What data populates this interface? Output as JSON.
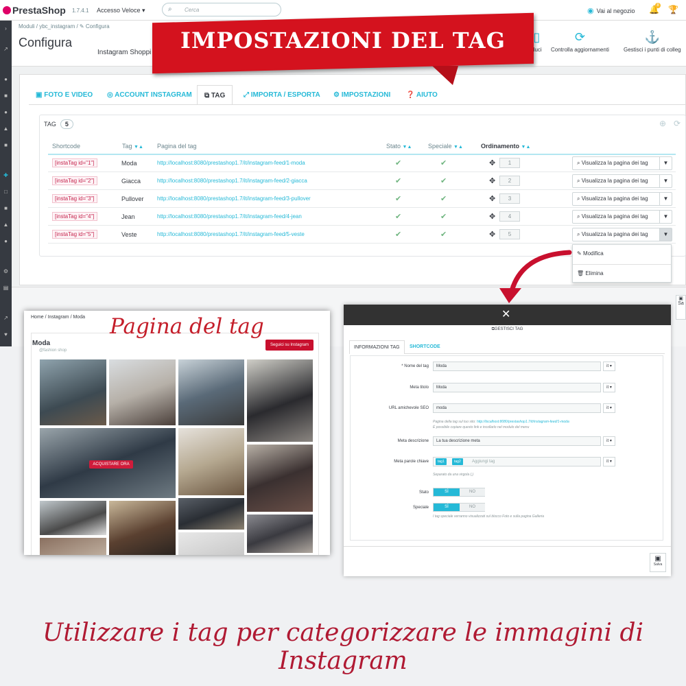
{
  "topbar": {
    "logo": "PrestaShop",
    "version": "1.7.4.1",
    "quick_access": "Accesso Veloce ▾",
    "search_placeholder": "Cerca",
    "view_shop": "Vai al negozio",
    "notif_count": "8"
  },
  "header": {
    "breadcrumb": "Moduli  /  ybc_instagram  /  ✎ Configura",
    "title": "Configura",
    "module_name": "Instagram Shoppi",
    "btn_products": "duci",
    "btn_check": "Controlla aggiornamenti",
    "btn_hooks": "Gestisci i punti di colleg"
  },
  "banner": {
    "text": "IMPOSTAZIONI DEL TAG"
  },
  "tabs": [
    {
      "label": "FOTO E VIDEO",
      "icon": "image-icon"
    },
    {
      "label": "ACCOUNT INSTAGRAM",
      "icon": "instagram-icon"
    },
    {
      "label": "TAG",
      "icon": "tags-icon"
    },
    {
      "label": "IMPORTA / ESPORTA",
      "icon": "arrows-icon"
    },
    {
      "label": "IMPOSTAZIONI",
      "icon": "cog-icon"
    },
    {
      "label": "AIUTO",
      "icon": "question-icon"
    }
  ],
  "list": {
    "heading": "TAG",
    "count": "5",
    "columns": {
      "shortcode": "Shortcode",
      "tag": "Tag",
      "page": "Pagina del tag",
      "stato": "Stato",
      "speciale": "Speciale",
      "ordinamento": "Ordinamento"
    },
    "rows": [
      {
        "shortcode": "[instaTag id=\"1\"]",
        "tag": "Moda",
        "url": "http://localhost:8080/prestashop1.7/it/instagram-feed/1-moda",
        "position": "1",
        "action": "Visualizza la pagina dei tag"
      },
      {
        "shortcode": "[instaTag id=\"2\"]",
        "tag": "Giacca",
        "url": "http://localhost:8080/prestashop1.7/it/instagram-feed/2-giacca",
        "position": "2",
        "action": "Visualizza la pagina dei tag"
      },
      {
        "shortcode": "[instaTag id=\"3\"]",
        "tag": "Pullover",
        "url": "http://localhost:8080/prestashop1.7/it/instagram-feed/3-pullover",
        "position": "3",
        "action": "Visualizza la pagina dei tag"
      },
      {
        "shortcode": "[instaTag id=\"4\"]",
        "tag": "Jean",
        "url": "http://localhost:8080/prestashop1.7/it/instagram-feed/4-jean",
        "position": "4",
        "action": "Visualizza la pagina dei tag"
      },
      {
        "shortcode": "[instaTag id=\"5\"]",
        "tag": "Veste",
        "url": "http://localhost:8080/prestashop1.7/it/instagram-feed/5-veste",
        "position": "5",
        "action": "Visualizza la pagina dei tag"
      }
    ],
    "dropdown": {
      "edit": "Modifica",
      "delete": "Elimina"
    }
  },
  "save_side": "Sa",
  "tag_page": {
    "label": "Pagina del tag",
    "breadcrumb": "Home  /  Instagram  /  Moda",
    "title": "Moda",
    "subtitle": "@fashion shop",
    "follow_btn": "Seguici su Instagram",
    "buy_btn": "ACQUISTARE ORA"
  },
  "modal": {
    "header": "GESTISCI TAG",
    "tab_info": "INFORMAZIONI TAG",
    "tab_shortcode": "SHORTCODE",
    "fields": {
      "name_label": "* Nome del tag",
      "name_value": "Moda",
      "meta_title_label": "Meta titolo",
      "meta_title_value": "Moda",
      "seo_url_label": "URL amichevole SEO",
      "seo_url_value": "moda",
      "seo_help_1": "Pagina della tag sul tuo sito: ",
      "seo_help_link": "http://localhost:8080/prestashop1.7/it/instagram-feed/1-moda",
      "seo_help_2": "È possibile copiare questo link e incollarlo nel modulo del menu",
      "meta_desc_label": "Meta descrizione",
      "meta_desc_value": "La tua descrizione meta",
      "meta_kw_label": "Meta parole chiave",
      "tag1": "tag1",
      "tag2": "tag2",
      "add_tag": "Aggiungi tag",
      "kw_help": "Separato da una virgola (,)",
      "stato_label": "Stato",
      "speciale_label": "Speciale",
      "si": "SÌ",
      "no": "NO",
      "spec_help": "I tag speciale verranno visualizzati sul blocco Foto e sulla pagina Galleria",
      "lang": "it ▾"
    },
    "save": "Salva"
  },
  "caption": "Utilizzare i tag per categorizzare le immagini di Instagram",
  "colors": {
    "accent": "#25b9d7",
    "banner": "#d4121e",
    "caption": "#b01a33",
    "check": "#70b580"
  }
}
